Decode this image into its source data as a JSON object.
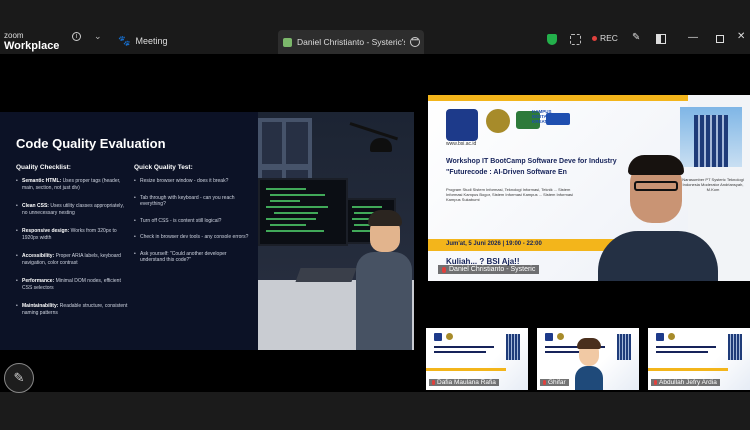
{
  "topbar": {
    "logo_line1": "zoom",
    "logo_line2": "Workplace",
    "info_glyph": "i",
    "chevron_glyph": "⌄",
    "meeting_tab_label": "Meeting",
    "share_tab_label": "Daniel Christianto - Systeric's scre",
    "more_glyph": "•••",
    "rec_label": "REC",
    "pen_glyph": "✎",
    "min_glyph": "—",
    "close_glyph": "✕",
    "rec_color": "#e0413d",
    "security_color": "#23b04b"
  },
  "slide": {
    "title": "Code Quality Evaluation",
    "checklist_heading": "Quality Checklist:",
    "test_heading": "Quick Quality Test:",
    "checklist": [
      {
        "label": "Semantic HTML:",
        "text": "Uses proper tags (header, main, section, not just div)"
      },
      {
        "label": "Clean CSS:",
        "text": "Uses utility classes appropriately, no unnecessary nesting"
      },
      {
        "label": "Responsive design:",
        "text": "Works from 320px to 1920px width"
      },
      {
        "label": "Accessibility:",
        "text": "Proper ARIA labels, keyboard navigation, color contrast"
      },
      {
        "label": "Performance:",
        "text": "Minimal DOM nodes, efficient CSS selectors"
      },
      {
        "label": "Maintainability:",
        "text": "Readable structure, consistent naming patterns"
      }
    ],
    "tests": [
      "Resize browser window - does it break?",
      "Tab through with keyboard - can you reach everything?",
      "Turn off CSS - is content still logical?",
      "Check in browser dev tools - any console errors?",
      "Ask yourself: \"Could another developer understand this code?\""
    ]
  },
  "speaker": {
    "url": "www.bsi.ac.id",
    "kdk_text": "KAMPUS DIGITAL KREATIF",
    "workshop_title": "Workshop IT BootCamp Software Deve       for Industry",
    "future_title": "\"Futurecode : AI-Driven Software En",
    "program_text": "Program Studi Sistem Informasi, Teknologi Informasi, Teknik ... Sistem Informasi Kampus Bogor, Sistem Informasi Kampus ... Sistem Informasi Kampus Sukabumi",
    "right_text": "Narasumber PT Systeric Teknologi Indonesia  Moderator Andriansyah, M.Kom",
    "date_text": "Jum'at, 5 Juni 2026 | 19:00 - 22:00",
    "kuliah_text": "Kuliah... ? BSI Aja!!",
    "name": "Daniel Christianto - Systeric"
  },
  "thumbnails": [
    {
      "name": "Dafia Maulana Rafia"
    },
    {
      "name": "Ghifar"
    },
    {
      "name": "Abdullah Jefry Ardia"
    }
  ],
  "controls": {
    "pen_glyph": "✎"
  }
}
